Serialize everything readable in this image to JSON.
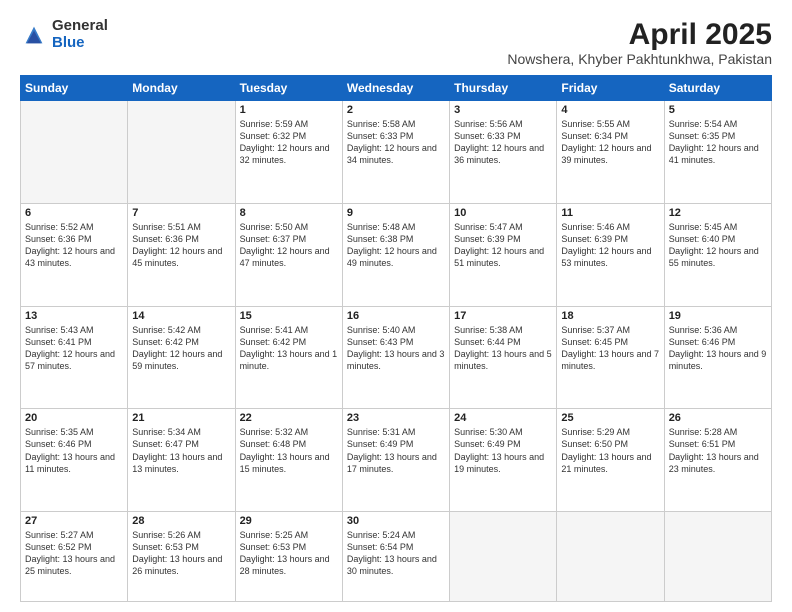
{
  "logo": {
    "general": "General",
    "blue": "Blue"
  },
  "title": "April 2025",
  "subtitle": "Nowshera, Khyber Pakhtunkhwa, Pakistan",
  "days_of_week": [
    "Sunday",
    "Monday",
    "Tuesday",
    "Wednesday",
    "Thursday",
    "Friday",
    "Saturday"
  ],
  "weeks": [
    [
      {
        "day": "",
        "info": ""
      },
      {
        "day": "",
        "info": ""
      },
      {
        "day": "1",
        "info": "Sunrise: 5:59 AM\nSunset: 6:32 PM\nDaylight: 12 hours and 32 minutes."
      },
      {
        "day": "2",
        "info": "Sunrise: 5:58 AM\nSunset: 6:33 PM\nDaylight: 12 hours and 34 minutes."
      },
      {
        "day": "3",
        "info": "Sunrise: 5:56 AM\nSunset: 6:33 PM\nDaylight: 12 hours and 36 minutes."
      },
      {
        "day": "4",
        "info": "Sunrise: 5:55 AM\nSunset: 6:34 PM\nDaylight: 12 hours and 39 minutes."
      },
      {
        "day": "5",
        "info": "Sunrise: 5:54 AM\nSunset: 6:35 PM\nDaylight: 12 hours and 41 minutes."
      }
    ],
    [
      {
        "day": "6",
        "info": "Sunrise: 5:52 AM\nSunset: 6:36 PM\nDaylight: 12 hours and 43 minutes."
      },
      {
        "day": "7",
        "info": "Sunrise: 5:51 AM\nSunset: 6:36 PM\nDaylight: 12 hours and 45 minutes."
      },
      {
        "day": "8",
        "info": "Sunrise: 5:50 AM\nSunset: 6:37 PM\nDaylight: 12 hours and 47 minutes."
      },
      {
        "day": "9",
        "info": "Sunrise: 5:48 AM\nSunset: 6:38 PM\nDaylight: 12 hours and 49 minutes."
      },
      {
        "day": "10",
        "info": "Sunrise: 5:47 AM\nSunset: 6:39 PM\nDaylight: 12 hours and 51 minutes."
      },
      {
        "day": "11",
        "info": "Sunrise: 5:46 AM\nSunset: 6:39 PM\nDaylight: 12 hours and 53 minutes."
      },
      {
        "day": "12",
        "info": "Sunrise: 5:45 AM\nSunset: 6:40 PM\nDaylight: 12 hours and 55 minutes."
      }
    ],
    [
      {
        "day": "13",
        "info": "Sunrise: 5:43 AM\nSunset: 6:41 PM\nDaylight: 12 hours and 57 minutes."
      },
      {
        "day": "14",
        "info": "Sunrise: 5:42 AM\nSunset: 6:42 PM\nDaylight: 12 hours and 59 minutes."
      },
      {
        "day": "15",
        "info": "Sunrise: 5:41 AM\nSunset: 6:42 PM\nDaylight: 13 hours and 1 minute."
      },
      {
        "day": "16",
        "info": "Sunrise: 5:40 AM\nSunset: 6:43 PM\nDaylight: 13 hours and 3 minutes."
      },
      {
        "day": "17",
        "info": "Sunrise: 5:38 AM\nSunset: 6:44 PM\nDaylight: 13 hours and 5 minutes."
      },
      {
        "day": "18",
        "info": "Sunrise: 5:37 AM\nSunset: 6:45 PM\nDaylight: 13 hours and 7 minutes."
      },
      {
        "day": "19",
        "info": "Sunrise: 5:36 AM\nSunset: 6:46 PM\nDaylight: 13 hours and 9 minutes."
      }
    ],
    [
      {
        "day": "20",
        "info": "Sunrise: 5:35 AM\nSunset: 6:46 PM\nDaylight: 13 hours and 11 minutes."
      },
      {
        "day": "21",
        "info": "Sunrise: 5:34 AM\nSunset: 6:47 PM\nDaylight: 13 hours and 13 minutes."
      },
      {
        "day": "22",
        "info": "Sunrise: 5:32 AM\nSunset: 6:48 PM\nDaylight: 13 hours and 15 minutes."
      },
      {
        "day": "23",
        "info": "Sunrise: 5:31 AM\nSunset: 6:49 PM\nDaylight: 13 hours and 17 minutes."
      },
      {
        "day": "24",
        "info": "Sunrise: 5:30 AM\nSunset: 6:49 PM\nDaylight: 13 hours and 19 minutes."
      },
      {
        "day": "25",
        "info": "Sunrise: 5:29 AM\nSunset: 6:50 PM\nDaylight: 13 hours and 21 minutes."
      },
      {
        "day": "26",
        "info": "Sunrise: 5:28 AM\nSunset: 6:51 PM\nDaylight: 13 hours and 23 minutes."
      }
    ],
    [
      {
        "day": "27",
        "info": "Sunrise: 5:27 AM\nSunset: 6:52 PM\nDaylight: 13 hours and 25 minutes."
      },
      {
        "day": "28",
        "info": "Sunrise: 5:26 AM\nSunset: 6:53 PM\nDaylight: 13 hours and 26 minutes."
      },
      {
        "day": "29",
        "info": "Sunrise: 5:25 AM\nSunset: 6:53 PM\nDaylight: 13 hours and 28 minutes."
      },
      {
        "day": "30",
        "info": "Sunrise: 5:24 AM\nSunset: 6:54 PM\nDaylight: 13 hours and 30 minutes."
      },
      {
        "day": "",
        "info": ""
      },
      {
        "day": "",
        "info": ""
      },
      {
        "day": "",
        "info": ""
      }
    ]
  ]
}
